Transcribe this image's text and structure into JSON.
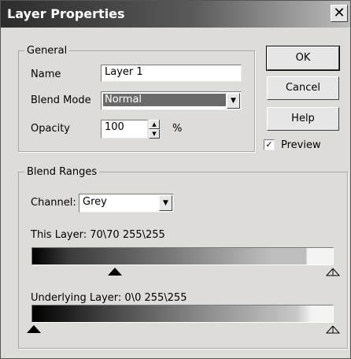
{
  "window": {
    "title": "Layer Properties",
    "close_glyph": "✕"
  },
  "general": {
    "group_label": "General",
    "name_label": "Name",
    "name_value": "Layer 1",
    "blend_mode_label": "Blend Mode",
    "blend_mode_value": "Normal",
    "opacity_label": "Opacity",
    "opacity_value": "100",
    "opacity_unit": "%"
  },
  "buttons": {
    "ok": "OK",
    "cancel": "Cancel",
    "help": "Help"
  },
  "preview": {
    "label": "Preview",
    "checked": true,
    "check_glyph": "✓"
  },
  "blend_ranges": {
    "group_label": "Blend Ranges",
    "channel_label": "Channel:",
    "channel_value": "Grey",
    "this_layer_label": "This Layer:  70\\70  255\\255",
    "this_layer_low": 70,
    "this_layer_high": 255,
    "underlying_label": "Underlying Layer:  0\\0  255\\255",
    "underlying_low": 0,
    "underlying_high": 255
  },
  "icons": {
    "dropdown": "chevron-down-icon",
    "spin_up": "spin-up-icon",
    "spin_down": "spin-down-icon"
  }
}
